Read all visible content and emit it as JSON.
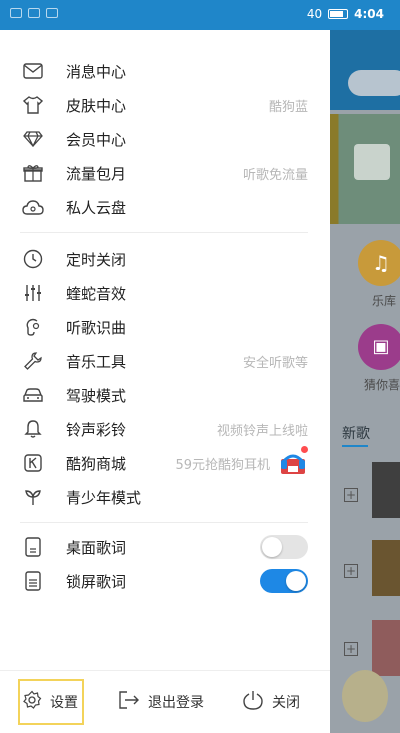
{
  "status_bar": {
    "time": "4:04",
    "battery": "40"
  },
  "drawer": {
    "sections": [
      {
        "items": [
          {
            "label": "消息中心",
            "hint": "",
            "icon": "mail-icon"
          },
          {
            "label": "皮肤中心",
            "hint": "酷狗蓝",
            "icon": "tshirt-icon"
          },
          {
            "label": "会员中心",
            "hint": "",
            "icon": "diamond-icon"
          },
          {
            "label": "流量包月",
            "hint": "听歌免流量",
            "icon": "gift-icon"
          },
          {
            "label": "私人云盘",
            "hint": "",
            "icon": "cloud-icon"
          }
        ]
      },
      {
        "items": [
          {
            "label": "定时关闭",
            "hint": "",
            "icon": "clock-icon"
          },
          {
            "label": "蝰蛇音效",
            "hint": "",
            "icon": "equalizer-icon"
          },
          {
            "label": "听歌识曲",
            "hint": "",
            "icon": "music-recognize-icon"
          },
          {
            "label": "音乐工具",
            "hint": "安全听歌等",
            "icon": "wrench-icon"
          },
          {
            "label": "驾驶模式",
            "hint": "",
            "icon": "car-icon"
          },
          {
            "label": "铃声彩铃",
            "hint": "视频铃声上线啦",
            "icon": "bell-icon"
          },
          {
            "label": "酷狗商城",
            "hint": "59元抢酷狗耳机",
            "icon": "shop-icon"
          },
          {
            "label": "青少年模式",
            "hint": "",
            "icon": "sprout-icon"
          }
        ]
      },
      {
        "items": [
          {
            "label": "桌面歌词",
            "toggle": false,
            "icon": "desktop-lyrics-icon"
          },
          {
            "label": "锁屏歌词",
            "toggle": true,
            "icon": "lockscreen-lyrics-icon"
          }
        ]
      }
    ],
    "footer": {
      "settings": "设置",
      "logout": "退出登录",
      "close": "关闭"
    }
  },
  "background": {
    "music_label": "乐库",
    "guess_label": "猜你喜",
    "new_songs": "新歌"
  },
  "colors": {
    "accent": "#1e88e5",
    "statusbar": "#1f86c9",
    "highlight": "#f3d35a"
  }
}
